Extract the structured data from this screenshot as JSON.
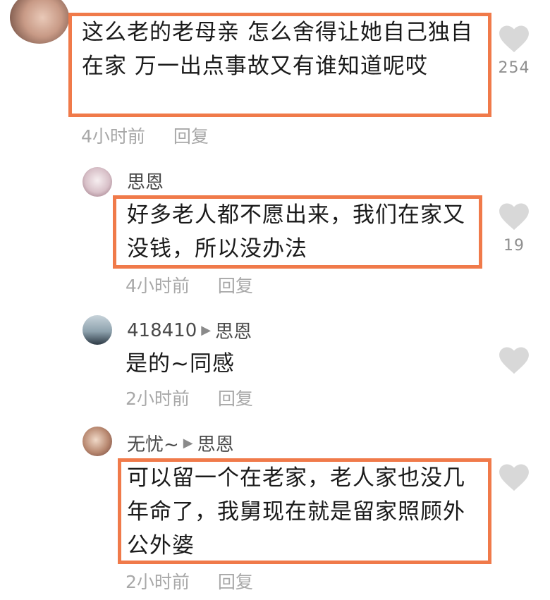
{
  "comments": [
    {
      "text": "这么老的老母亲 怎么舍得让她自己独自在家 万一出点事故又有谁知道呢哎",
      "time": "4小时前",
      "reply": "回复",
      "likes": "254"
    },
    {
      "user": "思恩",
      "text": "好多老人都不愿出来，我们在家又没钱，所以没办法",
      "time": "4小时前",
      "reply": "回复",
      "likes": "19"
    },
    {
      "user": "418410",
      "reply_to": "思恩",
      "text": "是的~同感",
      "time": "2小时前",
      "reply": "回复",
      "likes": ""
    },
    {
      "user": "无忧~",
      "reply_to": "思恩",
      "text": "可以留一个在老家，老人家也没几年命了，我舅现在就是留家照顾外公外婆",
      "time": "2小时前",
      "reply": "回复",
      "likes": ""
    }
  ],
  "colors": {
    "highlight": "#f07a4a",
    "heart": "#d8d8d8",
    "meta": "#a8a8a8"
  }
}
